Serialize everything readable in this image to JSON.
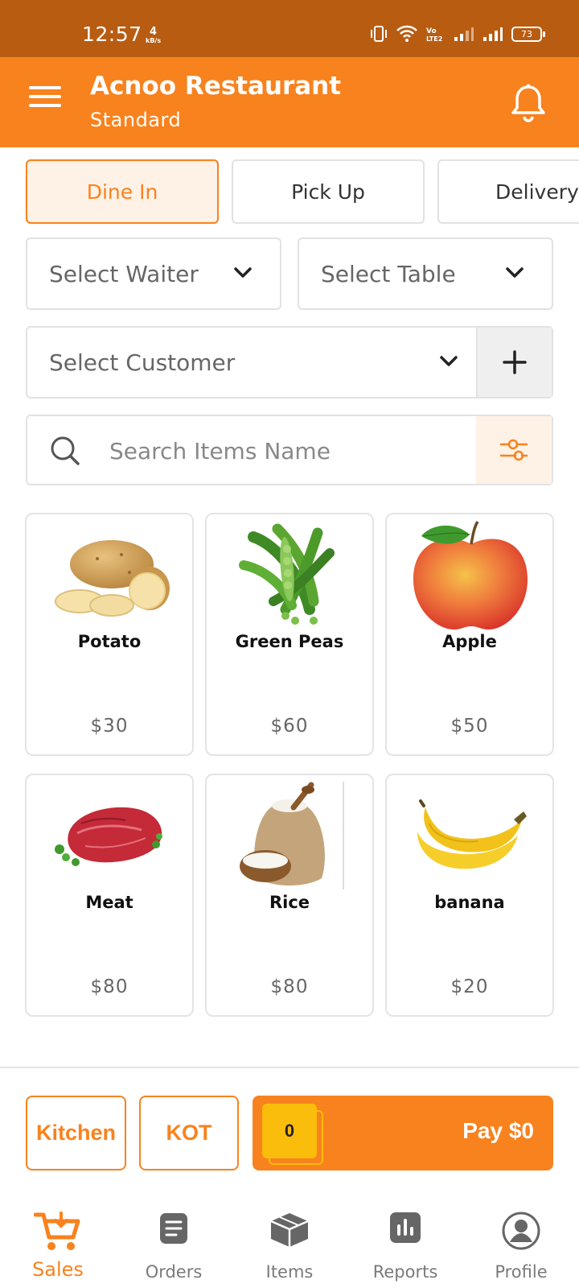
{
  "status_bar": {
    "time": "12:57",
    "net_speed_value": "4",
    "net_speed_unit": "kB/s",
    "battery": "73"
  },
  "app_bar": {
    "title": "Acnoo Restaurant",
    "subtitle": "Standard"
  },
  "order_tabs": [
    {
      "label": "Dine In",
      "active": true
    },
    {
      "label": "Pick Up",
      "active": false
    },
    {
      "label": "Delivery",
      "active": false
    }
  ],
  "selects": {
    "waiter": "Select Waiter",
    "table": "Select Table",
    "customer": "Select Customer"
  },
  "search": {
    "placeholder": "Search Items Name"
  },
  "products": [
    {
      "name": "Potato",
      "price": "$30",
      "image": "potato"
    },
    {
      "name": "Green Peas",
      "price": "$60",
      "image": "green-peas"
    },
    {
      "name": "Apple",
      "price": "$50",
      "image": "apple"
    },
    {
      "name": "Meat",
      "price": "$80",
      "image": "meat"
    },
    {
      "name": "Rice",
      "price": "$80",
      "image": "rice"
    },
    {
      "name": "banana",
      "price": "$20",
      "image": "banana"
    }
  ],
  "actions": {
    "kitchen": "Kitchen",
    "kot": "KOT",
    "cart_count": "0",
    "pay": "Pay $0"
  },
  "bottom_nav": [
    {
      "label": "Sales",
      "icon": "cart-icon",
      "active": true
    },
    {
      "label": "Orders",
      "icon": "orders-icon",
      "active": false
    },
    {
      "label": "Items",
      "icon": "box-icon",
      "active": false
    },
    {
      "label": "Reports",
      "icon": "chart-icon",
      "active": false
    },
    {
      "label": "Profile",
      "icon": "profile-icon",
      "active": false
    }
  ],
  "colors": {
    "primary": "#f8821e",
    "status_bar": "#b85c12",
    "badge": "#fbbd0b"
  }
}
